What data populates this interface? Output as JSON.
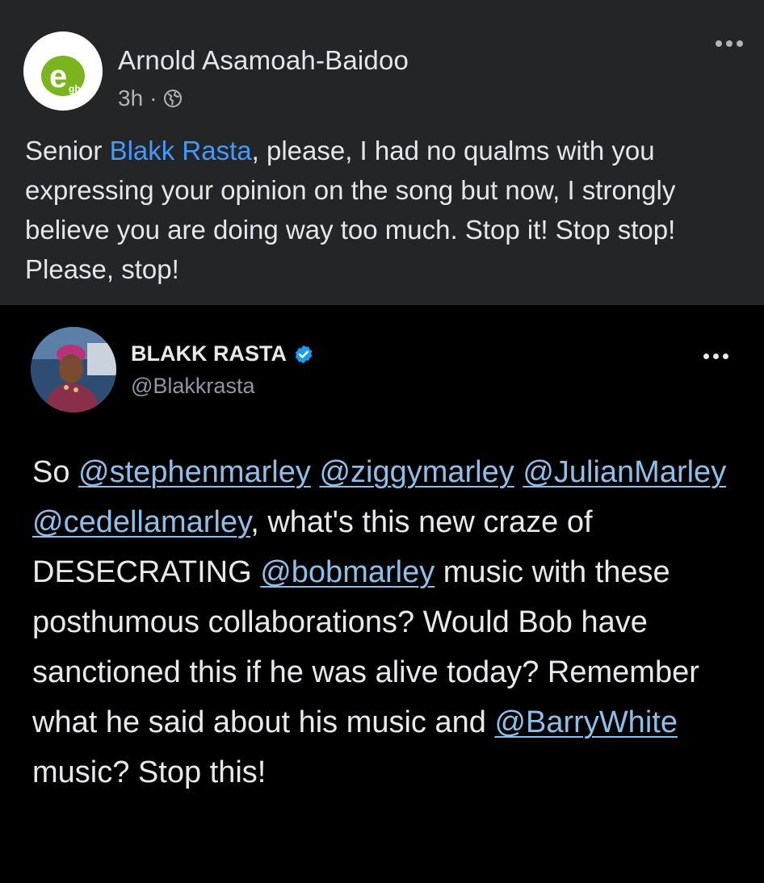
{
  "facebook_post": {
    "author": "Arnold Asamoah-Baidoo",
    "time": "3h",
    "separator": "·",
    "privacy_icon": "globe-icon",
    "avatar_logo_letter": "e",
    "avatar_logo_suffix": "gh",
    "text_parts": [
      {
        "type": "text",
        "value": "Senior "
      },
      {
        "type": "mention",
        "value": "Blakk Rasta"
      },
      {
        "type": "text",
        "value": ", please, I had no qualms with you expressing your opinion on the song but now, I strongly believe you are doing way too much. Stop it! Stop stop! Please, stop!"
      }
    ],
    "colors": {
      "background": "#242526",
      "mention": "#4599ff",
      "logo_green": "#7ab51d"
    }
  },
  "tweet": {
    "display_name": "BLAKK RASTA",
    "verified_icon": "verified-badge-icon",
    "handle": "@Blakkrasta",
    "text_parts": [
      {
        "type": "text",
        "value": "So "
      },
      {
        "type": "mention",
        "value": "@stephenmarley"
      },
      {
        "type": "text",
        "value": " "
      },
      {
        "type": "mention",
        "value": "@ziggymarley"
      },
      {
        "type": "text",
        "value": " "
      },
      {
        "type": "mention",
        "value": "@JulianMarley"
      },
      {
        "type": "text",
        "value": " "
      },
      {
        "type": "mention",
        "value": "@cedellamarley"
      },
      {
        "type": "text",
        "value": ", what's this new craze of DESECRATING "
      },
      {
        "type": "mention",
        "value": "@bobmarley"
      },
      {
        "type": "text",
        "value": " music with these posthumous collaborations? Would Bob have sanctioned this if he was alive today? Remember what he said about his music and "
      },
      {
        "type": "mention",
        "value": "@BarryWhite"
      },
      {
        "type": "text",
        "value": " music? Stop this!"
      }
    ],
    "colors": {
      "background": "#000000",
      "mention": "#8fbfe8",
      "verified": "#1d9bf0"
    }
  }
}
